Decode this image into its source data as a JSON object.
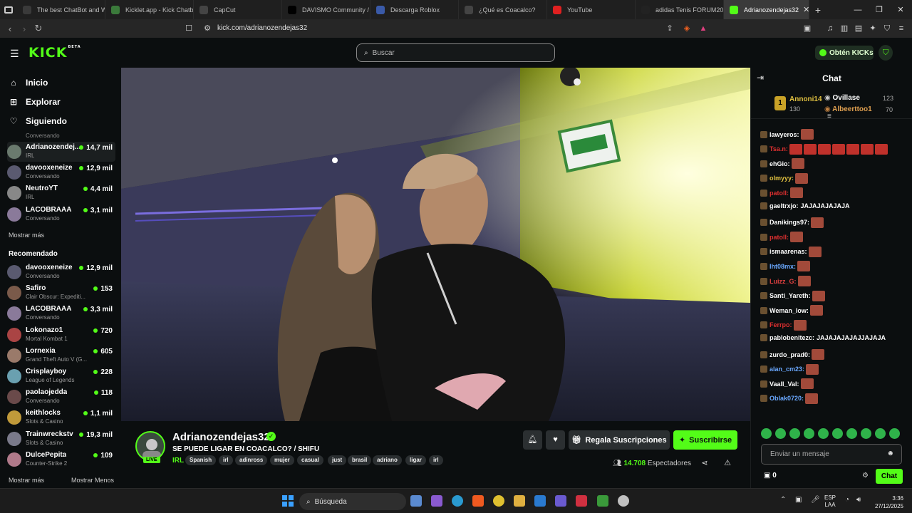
{
  "browser": {
    "tabs": [
      {
        "label": "The best ChatBot and Wi",
        "color": "#3a3a3a"
      },
      {
        "label": "Kicklet.app - Kick Chatbo",
        "color": "#3b7a3b"
      },
      {
        "label": "CapCut",
        "color": "#444"
      },
      {
        "label": "DAVISMO Community / X",
        "color": "#000"
      },
      {
        "label": "Descarga Roblox",
        "color": "#3a5aa8"
      },
      {
        "label": "¿Qué es Coacalco?",
        "color": "#444"
      },
      {
        "label": "YouTube",
        "color": "#e02020"
      },
      {
        "label": "adidas Tenis FORUM2000",
        "color": "#222"
      },
      {
        "label": "Adrianozendejas32",
        "color": "#53fc18"
      }
    ],
    "new_tab": "+",
    "url": "kick.com/adrianozendejas32"
  },
  "header": {
    "logo": "KICK",
    "logo_sup": "BETA",
    "search_placeholder": "Buscar",
    "get_kicks": "Obtén KICKs"
  },
  "sidebar": {
    "nav": [
      {
        "label": "Inicio",
        "icon": "home-icon"
      },
      {
        "label": "Explorar",
        "icon": "compass-icon"
      },
      {
        "label": "Siguiendo",
        "icon": "heart-icon"
      }
    ],
    "partial_top": "Conversando",
    "following": [
      {
        "name": "Adrianozendej...",
        "sub": "IRL",
        "viewers": "14,7 mil",
        "color": "#6a7a6e"
      },
      {
        "name": "davooxeneize",
        "sub": "Conversando",
        "viewers": "12,9 mil",
        "color": "#5a5a70"
      },
      {
        "name": "NeutroYT",
        "sub": "IRL",
        "viewers": "4,4 mil",
        "color": "#888"
      },
      {
        "name": "LACOBRAAA",
        "sub": "Conversando",
        "viewers": "3,1 mil",
        "color": "#8a7a9a"
      }
    ],
    "show_more_1": "Mostrar más",
    "recommended_title": "Recomendado",
    "recommended": [
      {
        "name": "davooxeneize",
        "sub": "Conversando",
        "viewers": "12,9 mil",
        "color": "#5a5a70"
      },
      {
        "name": "Safiro",
        "sub": "Clair Obscur: Expediti...",
        "viewers": "153",
        "color": "#7a5a4a"
      },
      {
        "name": "LACOBRAAA",
        "sub": "Conversando",
        "viewers": "3,3 mil",
        "color": "#8a7a9a"
      },
      {
        "name": "Lokonazo1",
        "sub": "Mortal Kombat 1",
        "viewers": "720",
        "color": "#aa4444"
      },
      {
        "name": "Lornexia",
        "sub": "Grand Theft Auto V (G...",
        "viewers": "605",
        "color": "#9a7a6a"
      },
      {
        "name": "Crisplayboy",
        "sub": "League of Legends",
        "viewers": "228",
        "color": "#6aa0b0"
      },
      {
        "name": "paolaojedda",
        "sub": "Conversando",
        "viewers": "118",
        "color": "#6a4a4a"
      },
      {
        "name": "keithlocks",
        "sub": "Slots & Casino",
        "viewers": "1,1 mil",
        "color": "#c09a3a"
      },
      {
        "name": "Trainwreckstv",
        "sub": "Slots & Casino",
        "viewers": "19,3 mil",
        "color": "#7a7a8a"
      },
      {
        "name": "DulcePepita",
        "sub": "Counter-Strike 2",
        "viewers": "109",
        "color": "#b07a8a"
      }
    ],
    "show_more_2": "Mostrar más",
    "show_less": "Mostrar Menos"
  },
  "stream": {
    "streamer": "Adrianozendejas32",
    "live_badge": "LIVE",
    "title": "SE PUEDE LIGAR EN COACALCO? / SHIFU",
    "category": "IRL",
    "tags": [
      "Spanish",
      "irl",
      "adinross",
      "mujer",
      "casual",
      "just",
      "brasil",
      "adriano",
      "ligar",
      "irl"
    ],
    "gift_label": "Regala Suscripciones",
    "subscribe_label": "Suscribirse",
    "viewers": "14.708",
    "viewers_label": "Espectadores"
  },
  "chat": {
    "title": "Chat",
    "leaderboard": {
      "rank": "1",
      "first": {
        "name": "Annoni14",
        "count": "130"
      },
      "second": {
        "name": "Ovillase",
        "count": "123"
      },
      "third": {
        "name": "Albeerttoo1",
        "count": "70"
      }
    },
    "messages": [
      {
        "user": "lawyeros:",
        "text": "",
        "color": "#ffffff",
        "emotes": 1
      },
      {
        "user": "Tsa.n:",
        "text": "",
        "color": "#e03030",
        "emotes": 8
      },
      {
        "user": "ehGio:",
        "text": "",
        "color": "#ffffff",
        "emotes": 1
      },
      {
        "user": "olmyyy:",
        "text": "",
        "color": "#e0c040",
        "emotes": 1
      },
      {
        "user": "patoll:",
        "text": "",
        "color": "#e03030",
        "emotes": 1
      },
      {
        "user": "gaeltrxjo:",
        "text": "JAJAJAJAJAJA",
        "color": "#ffffff",
        "emotes": 0
      },
      {
        "user": "Danikings97:",
        "text": "",
        "color": "#ffffff",
        "emotes": 1
      },
      {
        "user": "patoll:",
        "text": "",
        "color": "#e03030",
        "emotes": 1
      },
      {
        "user": "ismaarenas:",
        "text": "",
        "color": "#ffffff",
        "emotes": 1
      },
      {
        "user": "Iht08mx:",
        "text": "",
        "color": "#6aa8ff",
        "emotes": 1
      },
      {
        "user": "Luizz_G:",
        "text": "",
        "color": "#e04040",
        "emotes": 1
      },
      {
        "user": "Santi_Yareth:",
        "text": "",
        "color": "#ffffff",
        "emotes": 1
      },
      {
        "user": "Weman_low:",
        "text": "",
        "color": "#ffffff",
        "emotes": 1
      },
      {
        "user": "Ferrpo:",
        "text": "",
        "color": "#e03030",
        "emotes": 1
      },
      {
        "user": "pablobenitezc:",
        "text": "JAJAJAJAJAJJAJAJA",
        "color": "#ffffff",
        "emotes": 0
      },
      {
        "user": "zurdo_prad0:",
        "text": "",
        "color": "#ffffff",
        "emotes": 1
      },
      {
        "user": "alan_cm23:",
        "text": "",
        "color": "#6aa8ff",
        "emotes": 1
      },
      {
        "user": "Vaall_Val:",
        "text": "",
        "color": "#ffffff",
        "emotes": 1
      },
      {
        "user": "Oblak0720:",
        "text": "",
        "color": "#6aa8ff",
        "emotes": 1
      }
    ],
    "input_placeholder": "Enviar un mensaje",
    "points": "0",
    "send_label": "Chat"
  },
  "taskbar": {
    "search": "Búsqueda",
    "lang": "ESP",
    "lang_sub": "LAA",
    "time": "3:36",
    "date": "27/12/2025"
  }
}
